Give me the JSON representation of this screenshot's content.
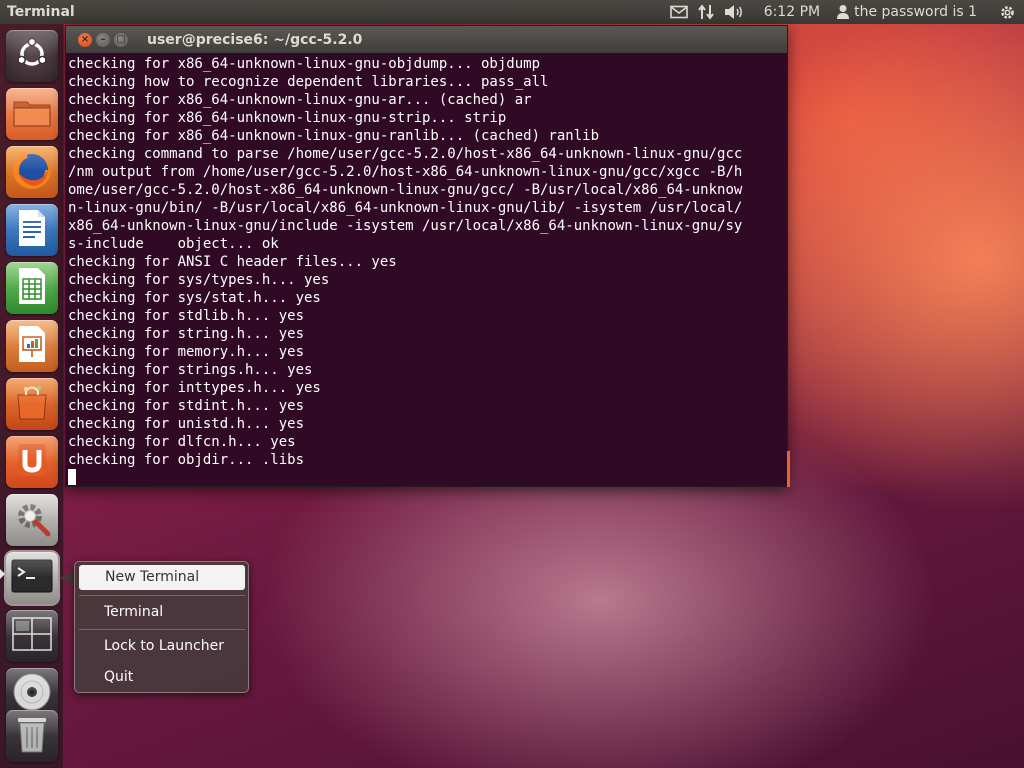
{
  "top_panel": {
    "app_title": "Terminal",
    "clock": "6:12 PM",
    "user": "the password is 1",
    "icons": [
      "mail-icon",
      "network-icon",
      "volume-icon",
      "user-icon",
      "session-gear-icon"
    ]
  },
  "launcher": {
    "items": [
      {
        "name": "dash-home",
        "icon": "ubuntu-logo-icon"
      },
      {
        "name": "home-folder",
        "icon": "folder-icon"
      },
      {
        "name": "firefox",
        "icon": "firefox-icon"
      },
      {
        "name": "libreoffice-writer",
        "icon": "writer-icon"
      },
      {
        "name": "libreoffice-calc",
        "icon": "calc-icon"
      },
      {
        "name": "libreoffice-impress",
        "icon": "impress-icon"
      },
      {
        "name": "software-center",
        "icon": "shopping-bag-icon"
      },
      {
        "name": "ubuntu-one",
        "icon": "ubuntu-one-icon"
      },
      {
        "name": "system-settings",
        "icon": "settings-wrench-icon"
      },
      {
        "name": "terminal",
        "icon": "terminal-icon"
      },
      {
        "name": "workspace-switcher",
        "icon": "workspaces-icon"
      },
      {
        "name": "cd-drive",
        "icon": "disc-icon"
      },
      {
        "name": "trash",
        "icon": "trash-icon"
      }
    ]
  },
  "terminal": {
    "title": "user@precise6: ~/gcc-5.2.0",
    "lines": [
      "checking for x86_64-unknown-linux-gnu-objdump... objdump",
      "checking how to recognize dependent libraries... pass_all",
      "checking for x86_64-unknown-linux-gnu-ar... (cached) ar",
      "checking for x86_64-unknown-linux-gnu-strip... strip",
      "checking for x86_64-unknown-linux-gnu-ranlib... (cached) ranlib",
      "checking command to parse /home/user/gcc-5.2.0/host-x86_64-unknown-linux-gnu/gcc",
      "/nm output from /home/user/gcc-5.2.0/host-x86_64-unknown-linux-gnu/gcc/xgcc -B/h",
      "ome/user/gcc-5.2.0/host-x86_64-unknown-linux-gnu/gcc/ -B/usr/local/x86_64-unknow",
      "n-linux-gnu/bin/ -B/usr/local/x86_64-unknown-linux-gnu/lib/ -isystem /usr/local/",
      "x86_64-unknown-linux-gnu/include -isystem /usr/local/x86_64-unknown-linux-gnu/sy",
      "s-include    object... ok",
      "checking for ANSI C header files... yes",
      "checking for sys/types.h... yes",
      "checking for sys/stat.h... yes",
      "checking for stdlib.h... yes",
      "checking for string.h... yes",
      "checking for memory.h... yes",
      "checking for strings.h... yes",
      "checking for inttypes.h... yes",
      "checking for stdint.h... yes",
      "checking for unistd.h... yes",
      "checking for dlfcn.h... yes",
      "checking for objdir... .libs"
    ]
  },
  "quicklist": {
    "items": [
      "New Terminal",
      "Terminal",
      "Lock to Launcher",
      "Quit"
    ],
    "highlighted": "New Terminal"
  }
}
